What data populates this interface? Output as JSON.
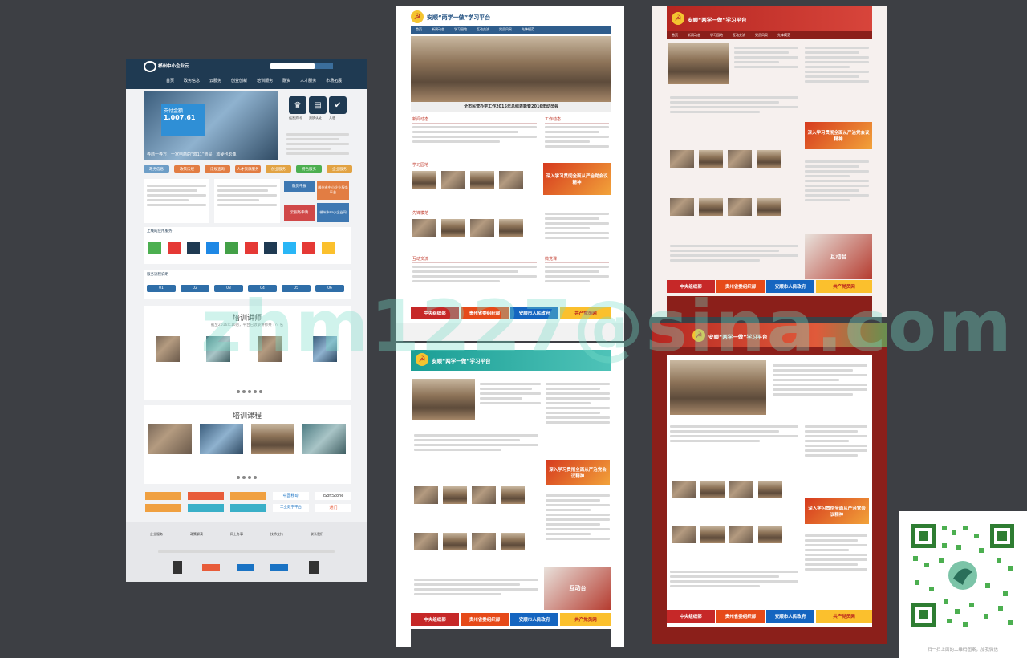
{
  "page1": {
    "logo_text": "郴州中小企业云",
    "nav": [
      "首页",
      "政务信息",
      "云服务",
      "创业创新",
      "培训服务",
      "融资",
      "人才服务",
      "市场拓展"
    ],
    "hero_caption": "券商一券万：一家电商的“双11”遗是！软硬也影像",
    "hero_labels": [
      "支付金额",
      "1,007,61"
    ],
    "tiles": [
      "运营资讯",
      "资质认证",
      "入驻"
    ],
    "tabs": [
      "政务信息",
      "政策法规",
      "法规查询",
      "人才资源服务",
      "创业服务",
      "特色服务",
      "企业服务"
    ],
    "side_buttons": [
      "融资申报",
      "郴州市中小企业服务平台",
      "云服务申请",
      "郴州市中小企业网"
    ],
    "section_apps": "上线的应用服务",
    "section_steps": "服务流程说明",
    "steps": [
      "01",
      "02",
      "03",
      "04",
      "05",
      "06"
    ],
    "expert_title": "培训讲师",
    "expert_sub": "截至2016年10月，平台已收录讲师共 ??? 名",
    "course_title": "培训课程",
    "partners": [
      "中国移动",
      "iSoftStone",
      "通门",
      "工业数字平台"
    ],
    "footer_links": [
      "企业服务",
      "政策解读",
      "网上办事",
      "技术支持",
      "联系我们"
    ]
  },
  "page2": {
    "title": "安顺“两学一做”学习平台",
    "nav": [
      "首页",
      "新闻动态",
      "学习园地",
      "互动交流",
      "党员风采",
      "先锋模范",
      "下载中心"
    ],
    "hero_caption": "全市民营办学工作2015年总结表彰暨2016年动员会",
    "banner_side": "深入学习贯彻全面从严治党会议精神",
    "sections": [
      "新闻动态",
      "工作动态",
      "学习园地",
      "先锋模范",
      "互动交流",
      "微党课"
    ],
    "bottom_banners": [
      "中央组织部",
      "贵州省委组织部",
      "安顺市人民政府",
      "共产党员网"
    ]
  },
  "page3": {
    "title": "安顺“两学一做”学习平台",
    "nav": [
      "首页",
      "新闻动态",
      "学习园地",
      "互动交流",
      "党员风采",
      "先锋模范",
      "下载中心"
    ],
    "banner_side": "深入学习贯彻全面从严治党会议精神",
    "interact": "互动台",
    "bottom_banners": [
      "中央组织部",
      "贵州省委组织部",
      "安顺市人民政府",
      "共产党员网"
    ]
  },
  "page4": {
    "title": "安顺“两学一做”学习平台",
    "banner_side": "深入学习贯彻全面从严治党会议精神",
    "interact": "互动台",
    "bottom_banners": [
      "中央组织部",
      "贵州省委组织部",
      "安顺市人民政府",
      "共产党员网"
    ]
  },
  "page5": {
    "title": "安顺“两学一做”学习平台",
    "banner_side": "深入学习贯彻全面从严治党会议精神",
    "bottom_banners": [
      "中央组织部",
      "贵州省委组织部",
      "安顺市人民政府",
      "共产党员网"
    ]
  },
  "watermark": "zhm1227@sina.com",
  "qr_caption": "扫一扫上面的二维码图案，加我微信",
  "colors": {
    "background": "#3d3f44",
    "page1_header": "#1f3a52",
    "page2_header": "#2f5d8c",
    "red_header": "#b52621",
    "teal_header": "#1a9e95",
    "dark_red": "#8b1f1a"
  }
}
